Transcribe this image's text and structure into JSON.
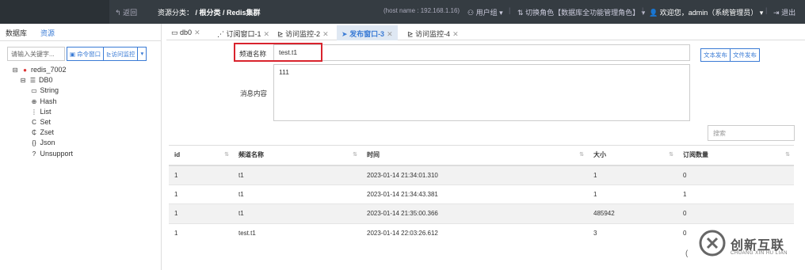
{
  "topbar": {
    "back": "返回",
    "crumb_label": "资源分类：",
    "crumb_path": "/ 根分类 / Redis集群",
    "host": "(host name : 192.168.1.16)",
    "user_group": "用户组",
    "switch_role": "切换角色【数据库全功能管理角色】",
    "welcome": "欢迎您，admin（系统管理员）",
    "logout": "退出"
  },
  "sidebar": {
    "tabs": [
      "数据库",
      "资源"
    ],
    "search_placeholder": "请输入关键字...",
    "buttons": [
      "命令窗口",
      "访问监控"
    ],
    "tree": {
      "server": "redis_7002",
      "db": "DB0",
      "types": [
        "String",
        "Hash",
        "List",
        "Set",
        "Zset",
        "Json",
        "Unsupport"
      ]
    }
  },
  "tabs": [
    {
      "label": "db0"
    },
    {
      "label": "订阅窗口-1"
    },
    {
      "label": "访问监控-2"
    },
    {
      "label": "发布窗口-3"
    },
    {
      "label": "访问监控-4"
    }
  ],
  "form": {
    "channel_label": "频道名称",
    "channel_value": "test.t1",
    "message_label": "消息内容",
    "message_value": "111",
    "btn_text": "文本发布",
    "btn_file": "文件发布",
    "table_search_placeholder": "搜索"
  },
  "table": {
    "headers": [
      "id",
      "频道名称",
      "时间",
      "大小",
      "订阅数量"
    ],
    "rows": [
      [
        "1",
        "t1",
        "2023-01-14 21:34:01.310",
        "1",
        "0"
      ],
      [
        "1",
        "t1",
        "2023-01-14 21:34:43.381",
        "1",
        "1"
      ],
      [
        "1",
        "t1",
        "2023-01-14 21:35:00.366",
        "485942",
        "0"
      ],
      [
        "1",
        "test.t1",
        "2023-01-14 22:03:26.612",
        "3",
        "0"
      ]
    ]
  },
  "watermark": {
    "brand": "创新互联",
    "sub": "CHUANG XIN HU LIAN"
  },
  "pagination_hint": "(",
  "colors": {
    "accent": "#3a7bd5",
    "highlight": "#d9232d",
    "topbar": "#353c42"
  }
}
